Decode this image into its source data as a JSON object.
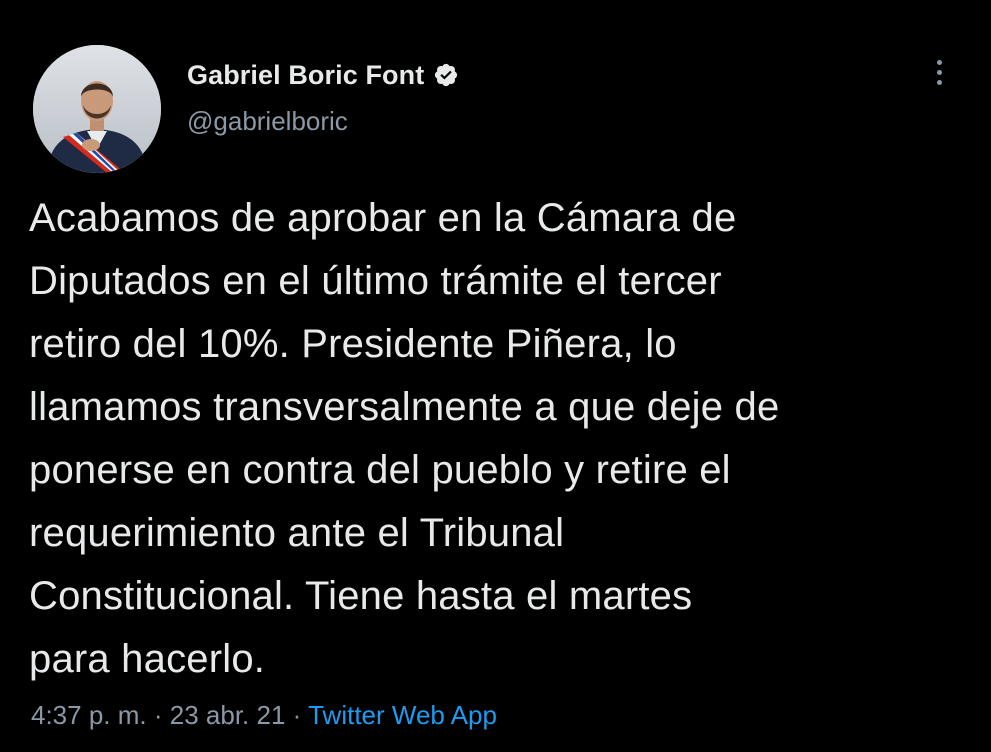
{
  "author": {
    "display_name": "Gabriel Boric Font",
    "handle": "@gabrielboric",
    "verified": true,
    "verified_icon": "verified-badge-icon"
  },
  "tweet": {
    "lines": [
      "Acabamos de aprobar en la Cámara de",
      "Diputados en el último trámite el tercer",
      "retiro del 10%. Presidente Piñera, lo",
      "llamamos transversalmente a que deje de",
      "ponerse en contra del pueblo y retire el",
      "requerimiento ante el Tribunal",
      "Constitucional. Tiene hasta el martes",
      "para hacerlo."
    ]
  },
  "meta": {
    "time": "4:37 p. m.",
    "separator": "·",
    "date": "23 abr. 21",
    "source": "Twitter Web App"
  },
  "menu": {
    "icon": "more-options-icon"
  },
  "colors": {
    "background": "#000000",
    "primary_text": "#e7e9ea",
    "secondary_text": "#8b98a5",
    "link": "#1d9bf0"
  }
}
